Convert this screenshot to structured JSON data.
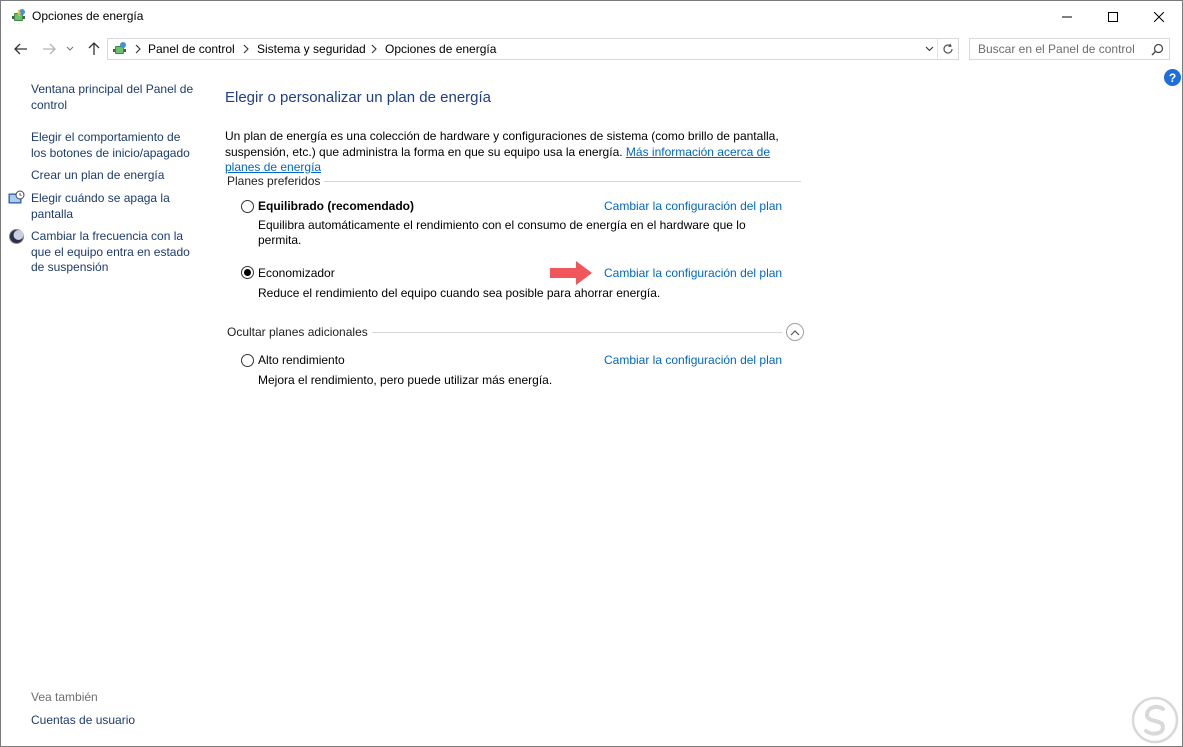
{
  "window": {
    "title": "Opciones de energía"
  },
  "address": {
    "breadcrumbs": [
      "Panel de control",
      "Sistema y seguridad",
      "Opciones de energía"
    ],
    "search_placeholder": "Buscar en el Panel de control"
  },
  "sidebar": {
    "items": [
      {
        "label_lines": [
          "Ventana principal del Panel de",
          "control"
        ],
        "icon": "none"
      },
      {
        "label_lines": [
          "Elegir el comportamiento de",
          "los botones de inicio/apagado"
        ],
        "icon": "none"
      },
      {
        "label_lines": [
          "Crear un plan de energía"
        ],
        "icon": "none"
      },
      {
        "label_lines": [
          "Elegir cuándo se apaga la",
          "pantalla"
        ],
        "icon": "monitor-clock-icon"
      },
      {
        "label_lines": [
          "Cambiar la frecuencia con la",
          "que el equipo entra en estado",
          "de suspensión"
        ],
        "icon": "moon-icon"
      }
    ],
    "see_also_label": "Vea también",
    "see_also_links": [
      "Cuentas de usuario"
    ]
  },
  "main": {
    "title": "Elegir o personalizar un plan de energía",
    "intro_text": "Un plan de energía es una colección de hardware y configuraciones de sistema (como brillo de pantalla, suspensión, etc.) que administra la forma en que su equipo usa la energía. ",
    "intro_link": "Más información acerca de planes de energía",
    "preferred_label": "Planes preferidos",
    "additional_label": "Ocultar planes adicionales",
    "plans": [
      {
        "name": "Equilibrado (recomendado)",
        "bold": true,
        "selected": false,
        "description": "Equilibra automáticamente el rendimiento con el consumo de energía en el hardware que lo permita.",
        "link": "Cambiar la configuración del plan"
      },
      {
        "name": "Economizador",
        "bold": false,
        "selected": true,
        "description": "Reduce el rendimiento del equipo cuando sea posible para ahorrar energía.",
        "link": "Cambiar la configuración del plan"
      },
      {
        "name": "Alto rendimiento",
        "bold": false,
        "selected": false,
        "description": "Mejora el rendimiento, pero puede utilizar más energía.",
        "link": "Cambiar la configuración del plan"
      }
    ]
  },
  "colors": {
    "link": "#0066cc",
    "sidebar_link": "#1c3b72",
    "heading": "#1e3e8a",
    "arrow": "#f0565a"
  }
}
